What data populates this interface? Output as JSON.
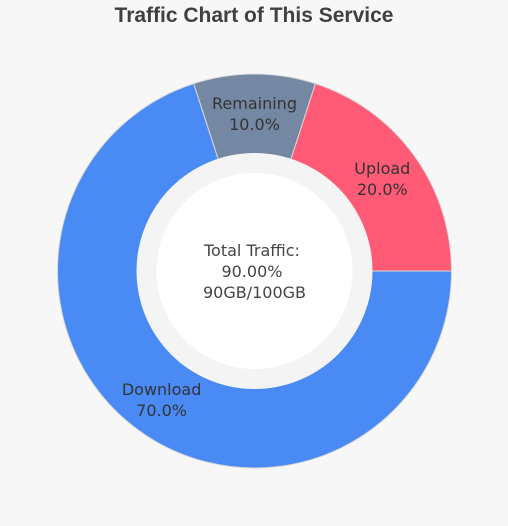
{
  "chart_data": {
    "type": "pie",
    "variant": "donut",
    "title": "Traffic Chart of This Service",
    "categories": [
      "Upload",
      "Remaining",
      "Download"
    ],
    "values": [
      20.0,
      10.0,
      70.0
    ],
    "percent_labels": [
      "20.0%",
      "10.0%",
      "70.0%"
    ],
    "colors": [
      "#ff5a76",
      "#7488a3",
      "#4a8af5"
    ],
    "start_angle_deg": 0,
    "direction": "counterclockwise",
    "center_text": [
      "Total Traffic:",
      "90.00%",
      "90GB/100GB"
    ],
    "legend": "none",
    "grid": false
  }
}
